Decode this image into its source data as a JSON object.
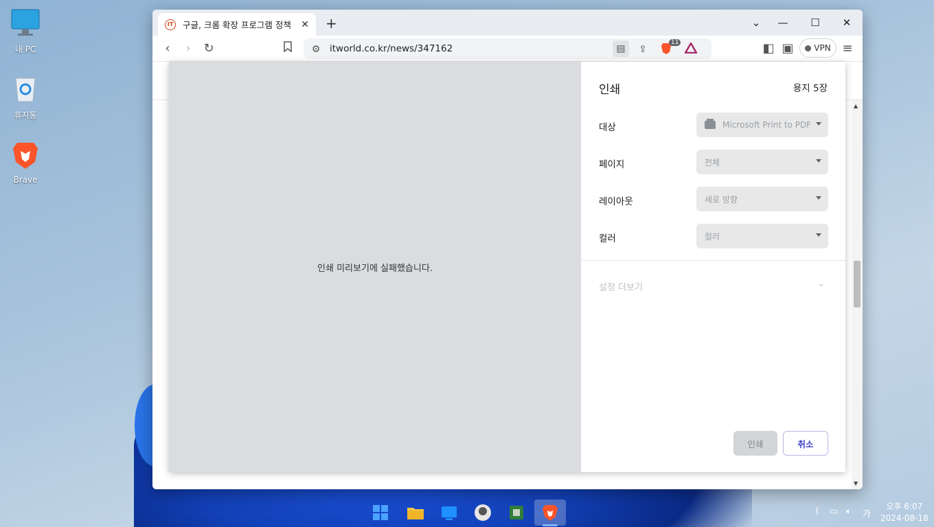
{
  "desktop": {
    "icons": [
      {
        "label": "내 PC"
      },
      {
        "label": "휴지통"
      },
      {
        "label": "Brave"
      }
    ]
  },
  "browser": {
    "tab": {
      "favicon_text": "IT",
      "title": "구글, 크롬 확장 프로그램 정책"
    },
    "url": "itworld.co.kr/news/347162",
    "shields_badge": "11",
    "vpn_label": "VPN"
  },
  "print_dialog": {
    "title": "인쇄",
    "page_count": "용지 5장",
    "preview_message": "인쇄 미리보기에 실패했습니다.",
    "rows": [
      {
        "label": "대상",
        "value": "Microsoft Print to PDF"
      },
      {
        "label": "페이지",
        "value": "전체"
      },
      {
        "label": "레이아웃",
        "value": "세로 방향"
      },
      {
        "label": "컬러",
        "value": "컬러"
      }
    ],
    "more_settings": "설정 더보기",
    "print_button": "인쇄",
    "cancel_button": "취소"
  },
  "taskbar": {
    "tray_ime": "가",
    "clock_time": "오후 6:07",
    "clock_date": "2024-08-18"
  }
}
